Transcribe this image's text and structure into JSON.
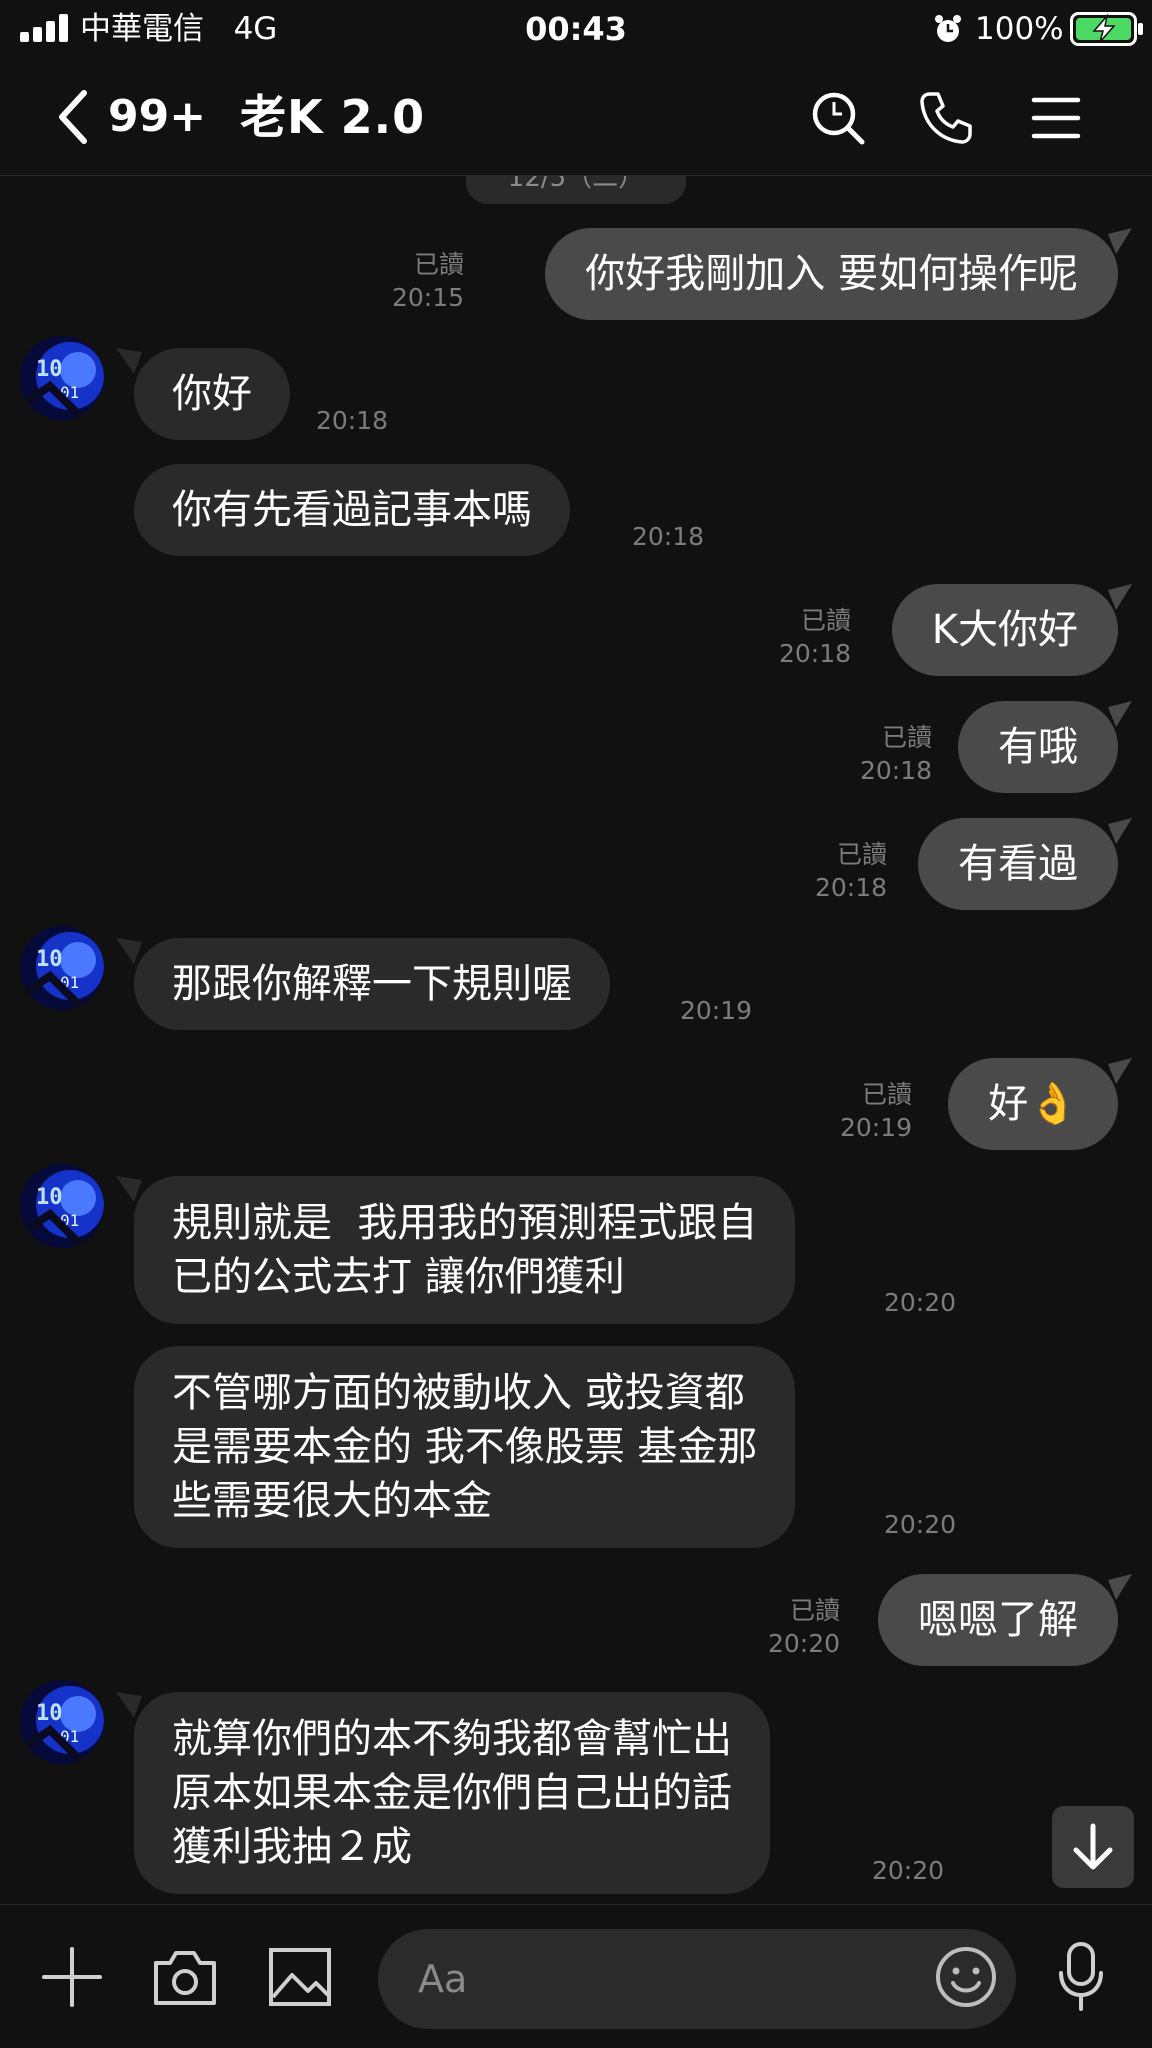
{
  "status_bar": {
    "carrier": "中華電信",
    "network": "4G",
    "time": "00:43",
    "battery_percent": "100%"
  },
  "header": {
    "unread_count": "99+",
    "chat_title": "老K 2.0",
    "icons": [
      "chevron-left-icon",
      "search-icon",
      "phone-icon",
      "menu-icon"
    ]
  },
  "chat": {
    "messages": [
      {
        "side": "out",
        "text": "你好我剛加入 要如何操作呢",
        "read": "已讀",
        "time": "20:15"
      },
      {
        "side": "in",
        "text": "你好",
        "time": "20:18"
      },
      {
        "side": "in",
        "text": "你有先看過記事本嗎",
        "time": "20:18"
      },
      {
        "side": "out",
        "text": "K大你好",
        "read": "已讀",
        "time": "20:18"
      },
      {
        "side": "out",
        "text": "有哦",
        "read": "已讀",
        "time": "20:18"
      },
      {
        "side": "out",
        "text": "有看過",
        "read": "已讀",
        "time": "20:18"
      },
      {
        "side": "in",
        "text": "那跟你解釋一下規則喔",
        "time": "20:19"
      },
      {
        "side": "out",
        "text": "好👌",
        "read": "已讀",
        "time": "20:19"
      },
      {
        "side": "in",
        "text": "規則就是  我用我的預測程式跟自\n已的公式去打 讓你們獲利",
        "time": "20:20"
      },
      {
        "side": "in",
        "text": "不管哪方面的被動收入 或投資都\n是需要本金的 我不像股票 基金那\n些需要很大的本金",
        "time": "20:20"
      },
      {
        "side": "out",
        "text": "嗯嗯了解",
        "read": "已讀",
        "time": "20:20"
      },
      {
        "side": "in",
        "text": "就算你們的本不夠我都會幫忙出\n原本如果本金是你們自己出的話\n獲利我抽２成",
        "time": "20:20"
      }
    ]
  },
  "input_bar": {
    "placeholder": "Aa",
    "icons": [
      "plus-icon",
      "camera-icon",
      "image-icon",
      "emoji-icon",
      "microphone-icon"
    ]
  },
  "colors": {
    "background": "#111111",
    "outgoing_bubble": "#4a4a4a",
    "incoming_bubble": "#2a2a2a",
    "meta_text": "#7c7c7c",
    "battery_green": "#4cd964"
  }
}
